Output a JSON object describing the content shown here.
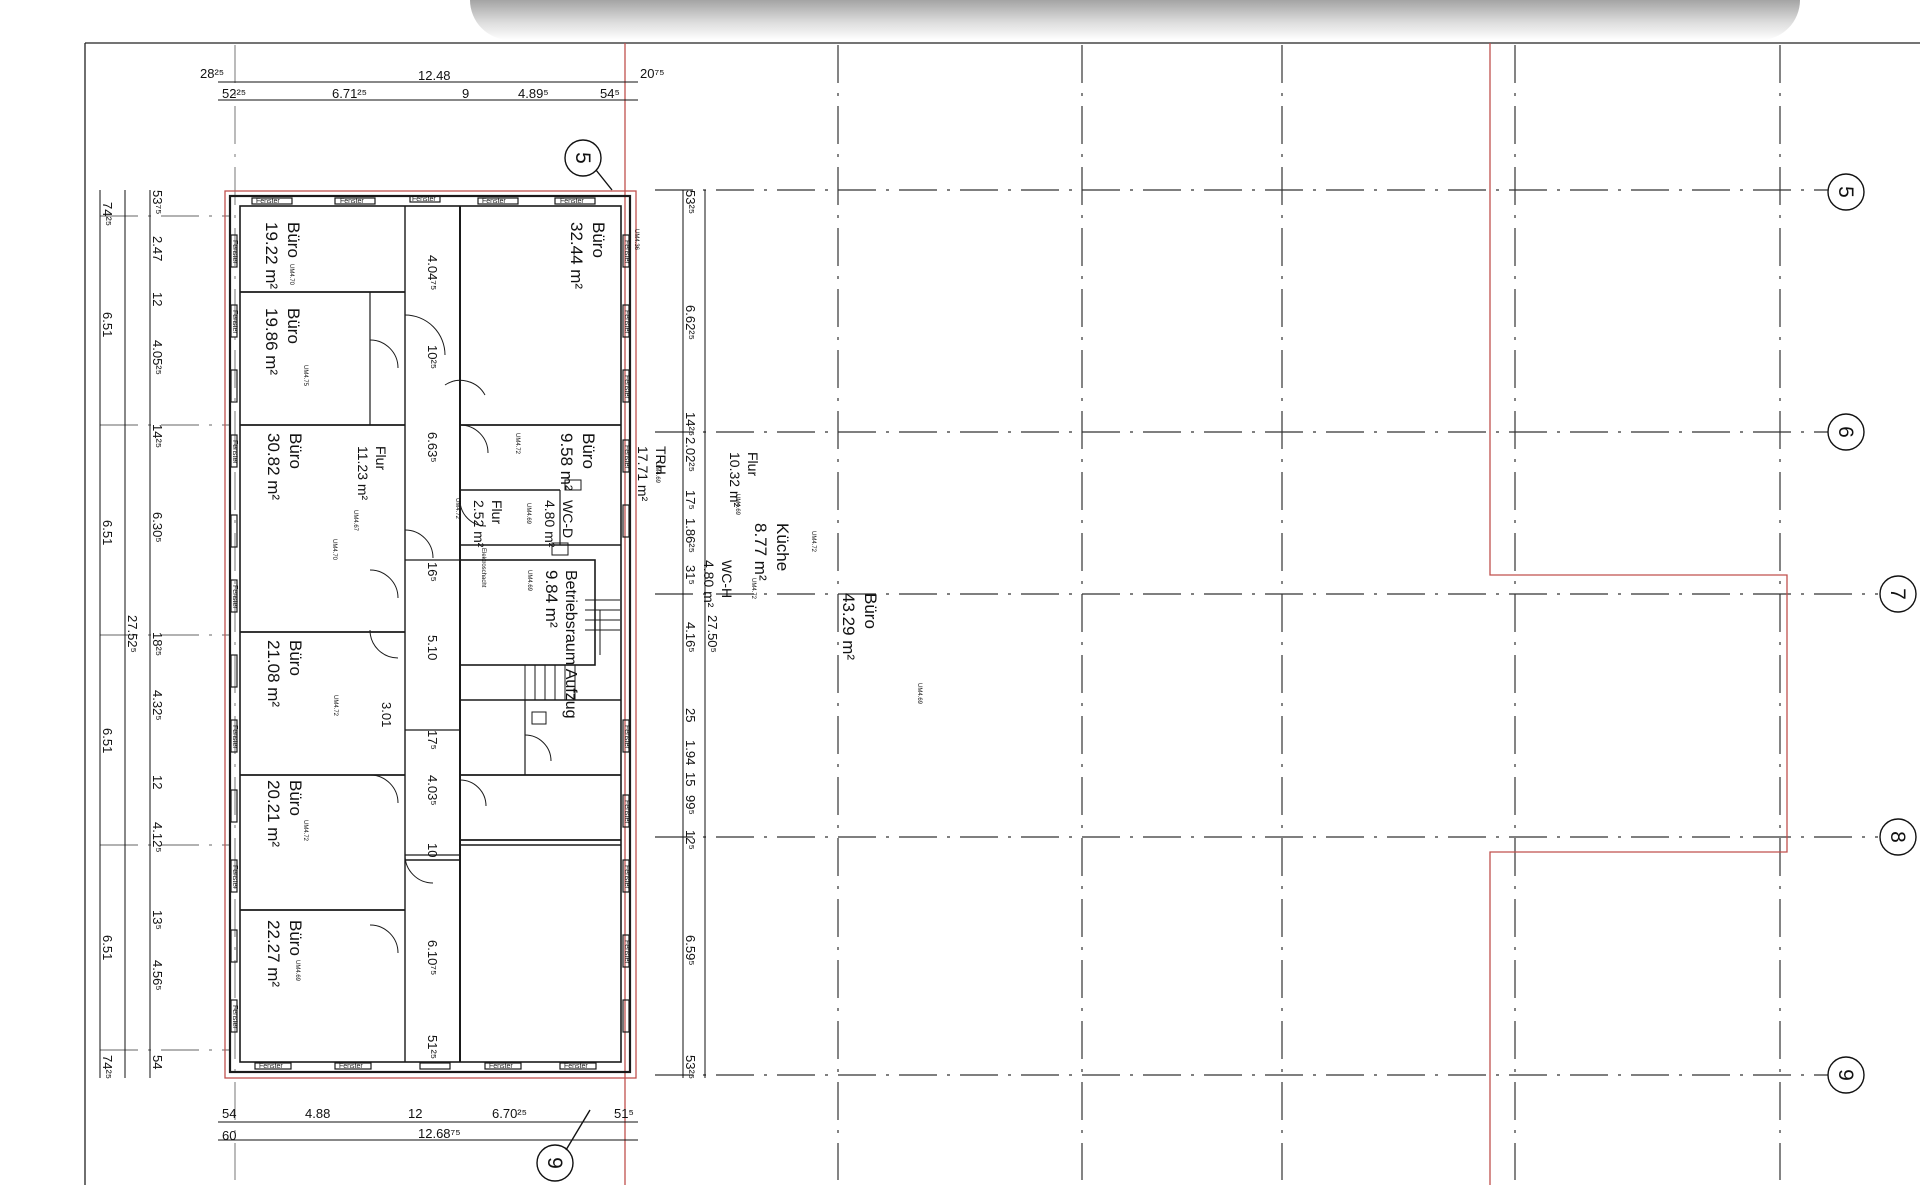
{
  "plan": {
    "dims": {
      "top_total": "12.48",
      "top_left_edge": "28²⁵",
      "top_right_edge": "20⁷⁵",
      "top_seg_a": "52²⁵",
      "top_seg_b": "6.71²⁵",
      "top_seg_c": "9",
      "top_seg_d": "4.89⁵",
      "top_seg_e": "54⁵",
      "bottom_total": "12.68⁷⁵",
      "bottom_seg_a": "54",
      "bottom_seg_b": "4.88",
      "bottom_seg_c": "12",
      "bottom_seg_d": "6.70²⁵",
      "bottom_seg_e": "51⁵",
      "bottom_seg_f": "60",
      "left_total": "27.52⁵",
      "left_axis": [
        "74²⁵",
        "6.51",
        "6.51",
        "6.51",
        "6.51",
        "74²⁵"
      ],
      "left_rooms": [
        "53⁷⁵",
        "2.47",
        "12",
        "4.05²⁵",
        "14²⁵",
        "6.30⁵",
        "18²⁵",
        "4.32⁵",
        "12",
        "4.12⁵",
        "13⁵",
        "4.56⁵",
        "54"
      ],
      "right_total": "27.50⁵",
      "right_rooms": [
        "53²⁵",
        "6.62²⁵",
        "14²⁵",
        "2.02²⁵",
        "17⁵",
        "1.86²⁵",
        "31⁵",
        "4.16⁵",
        "25",
        "1.94",
        "15",
        "99⁵",
        "12⁵",
        "6.59⁵",
        "53²⁵"
      ],
      "inner_dims": [
        "4.04⁷⁵",
        "10²⁵",
        "6.63⁵",
        "16⁵",
        "5.10",
        "17⁵",
        "4.03⁵",
        "10",
        "6.10⁷⁵",
        "51²⁵"
      ]
    },
    "rooms": [
      {
        "name": "Büro",
        "area": "19.22 m²",
        "code": "UM4.70"
      },
      {
        "name": "Büro",
        "area": "19.86 m²",
        "code": "UM4.75"
      },
      {
        "name": "Büro",
        "area": "30.82 m²",
        "code": "UM4.70"
      },
      {
        "name": "Büro",
        "area": "21.08 m²",
        "code": "UM4.72"
      },
      {
        "name": "Büro",
        "area": "20.21 m²",
        "code": "UM4.72"
      },
      {
        "name": "Büro",
        "area": "22.27 m²",
        "code": "UM4.69"
      },
      {
        "name": "Büro",
        "area": "32.44 m²",
        "code": "UM4.36"
      },
      {
        "name": "Büro",
        "area": "9.58 m²",
        "code": "UM4.72"
      },
      {
        "name": "WC-D",
        "area": "4.80 m²",
        "code": "UM4.69"
      },
      {
        "name": "Flur",
        "area": "2.52 m²",
        "code": "UM4.72"
      },
      {
        "name": "Betriebsraum Aufzug",
        "area": "9.84 m²",
        "code": "UM4.69"
      },
      {
        "name": "Flur",
        "area": "11.23 m²",
        "code": "UM4.67"
      },
      {
        "name": "TRH",
        "area": "17.71 m²",
        "code": "UM4.69"
      },
      {
        "name": "WC-H",
        "area": "4.80 m²",
        "code": "UM4.72"
      },
      {
        "name": "Flur",
        "area": "10.32 m²",
        "code": "UM4.69"
      },
      {
        "name": "Küche",
        "area": "8.77 m²",
        "code": "UM4.72"
      },
      {
        "name": "Büro",
        "area": "43.29 m²",
        "code": "UM4.69"
      }
    ],
    "window_label": "Fenster",
    "misc_label": "3.01",
    "shaft_label": "Elektroschacht",
    "axes": [
      "5",
      "6",
      "7",
      "8",
      "9"
    ],
    "colors": {
      "line": "#1a1a1a",
      "outline": "#c0504d",
      "grid": "#333333"
    }
  }
}
